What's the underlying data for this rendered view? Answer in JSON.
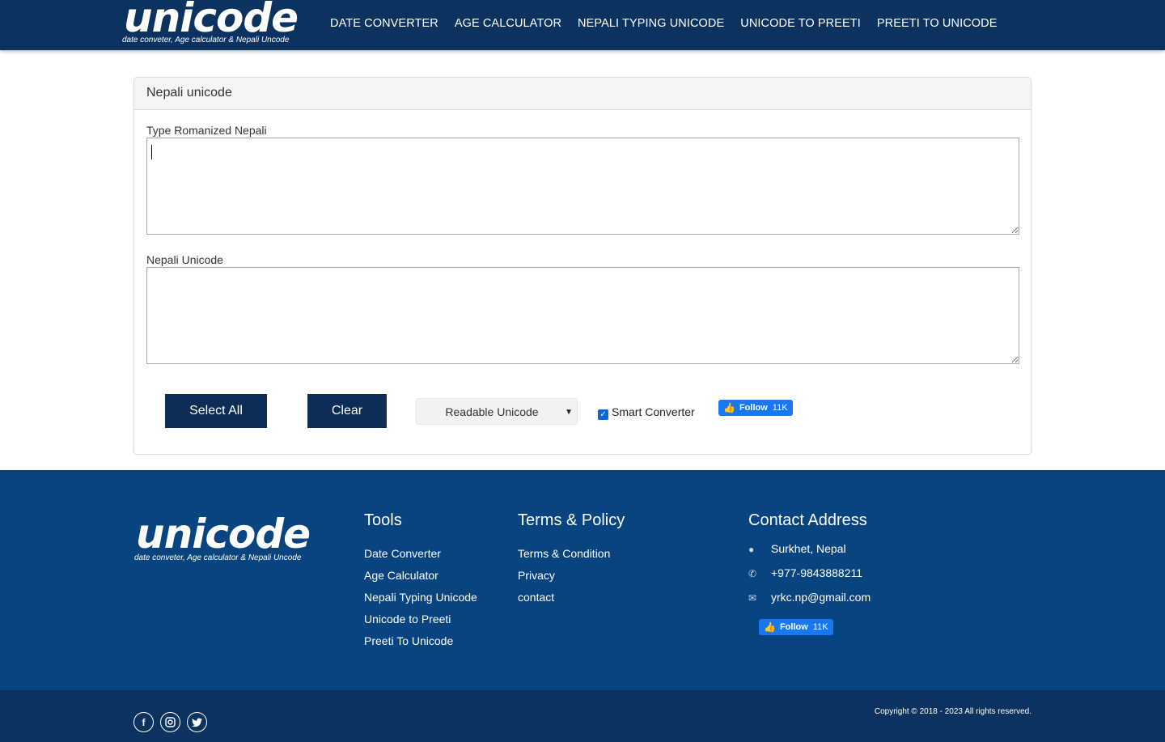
{
  "header": {
    "logo_word": "unicode",
    "logo_tagline": "date conveter, Age calculator & Nepali Uncode",
    "nav": [
      "DATE CONVERTER",
      "AGE CALCULATOR",
      "NEPALI TYPING UNICODE",
      "UNICODE TO PREETI",
      "PREETI TO UNICODE"
    ]
  },
  "panel": {
    "title": "Nepali unicode",
    "input_label": "Type Romanized Nepali",
    "input_value": "",
    "output_label": "Nepali Unicode",
    "output_value": "",
    "select_all_label": "Select All",
    "clear_label": "Clear",
    "mode_select_value": "Readable Unicode",
    "smart_converter_label": "Smart Converter",
    "smart_converter_checked": true,
    "fb_follow_label": "Follow",
    "fb_follow_count": "11K"
  },
  "footer": {
    "logo_word": "unicode",
    "logo_tagline": "date conveter, Age calculator & Nepali Uncode",
    "tools_title": "Tools",
    "tools": [
      "Date Converter",
      "Age Calculator",
      "Nepali Typing Unicode",
      "Unicode to Preeti",
      "Preeti To Unicode"
    ],
    "terms_title": "Terms & Policy",
    "terms": [
      "Terms & Condition",
      "Privacy",
      "contact"
    ],
    "contact_title": "Contact Address",
    "address": "Surkhet, Nepal",
    "phone": "+977-9843888211",
    "email": "yrkc.np@gmail.com",
    "fb_follow_label": "Follow",
    "fb_follow_count": "11K",
    "copyright": "Copyright © 2018 - 2023 All rights reserved."
  },
  "colors": {
    "header_bg": "#0c3360",
    "footer_bg": "#08447f",
    "button_bg": "#0c2d55",
    "fb_blue": "#1877f2"
  }
}
